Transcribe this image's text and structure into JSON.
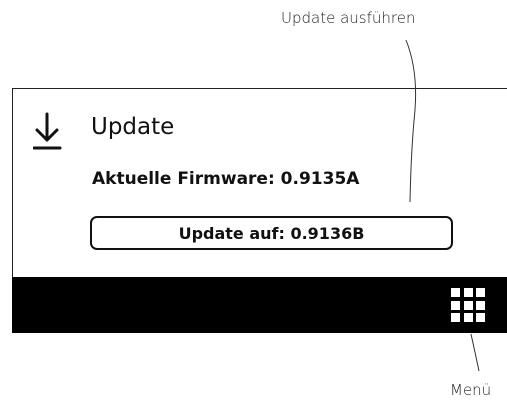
{
  "callouts": {
    "update_action": "Update ausführen",
    "menu": "Menü"
  },
  "screen": {
    "title": "Update",
    "title_icon": "download-arrow-icon",
    "current_firmware": "Aktuelle Firmware: 0.9135A",
    "update_button_label": "Update auf: 0.9136B"
  },
  "bottom_bar": {
    "menu_icon": "grid-menu-icon"
  },
  "colors": {
    "foreground": "#111111",
    "background": "#ffffff",
    "bar": "#000000"
  }
}
